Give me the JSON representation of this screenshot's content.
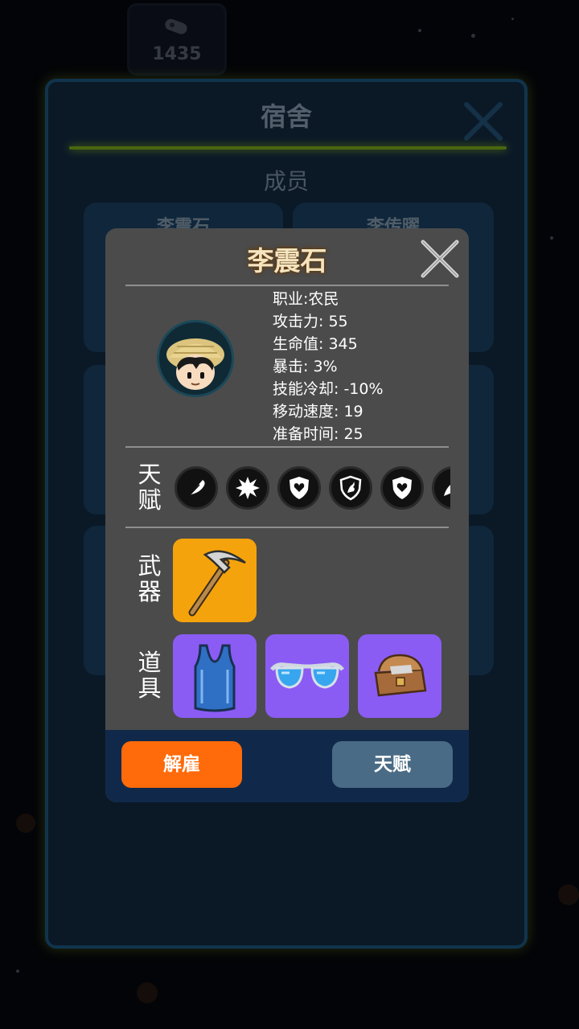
{
  "currency": {
    "value": "1435",
    "icon": "gem-icon"
  },
  "dormitory": {
    "title": "宿舍",
    "subtitle": "成员",
    "members": [
      {
        "name": "李震石"
      },
      {
        "name": "李传曜"
      }
    ]
  },
  "character": {
    "name": "李震石",
    "stats": [
      "职业:农民",
      "攻击力: 55",
      "生命值: 345",
      "暴击: 3%",
      "技能冷却: -10%",
      "移动速度: 19",
      "准备时间: 25"
    ],
    "talent_label": "天赋",
    "talents": [
      "feather-icon",
      "burst-icon",
      "shield-heart-icon",
      "shield-dragon-icon",
      "shield-heart-icon",
      "wing-icon"
    ],
    "weapon_label": "武器",
    "weapon": {
      "icon": "pickaxe-icon",
      "color": "#f5a30c"
    },
    "items_label": "道具",
    "items": [
      {
        "icon": "tank-top-icon",
        "color": "#8a5cf4"
      },
      {
        "icon": "sunglasses-icon",
        "color": "#8a5cf4"
      },
      {
        "icon": "treasure-chest-icon",
        "color": "#8a5cf4"
      }
    ],
    "fire_button": "解雇",
    "talent_button": "天赋"
  },
  "colors": {
    "accent_orange": "#ff6a0a",
    "button_slate": "#4a6b86",
    "panel_border": "#1d5a86",
    "glow_green": "#a9e020"
  }
}
